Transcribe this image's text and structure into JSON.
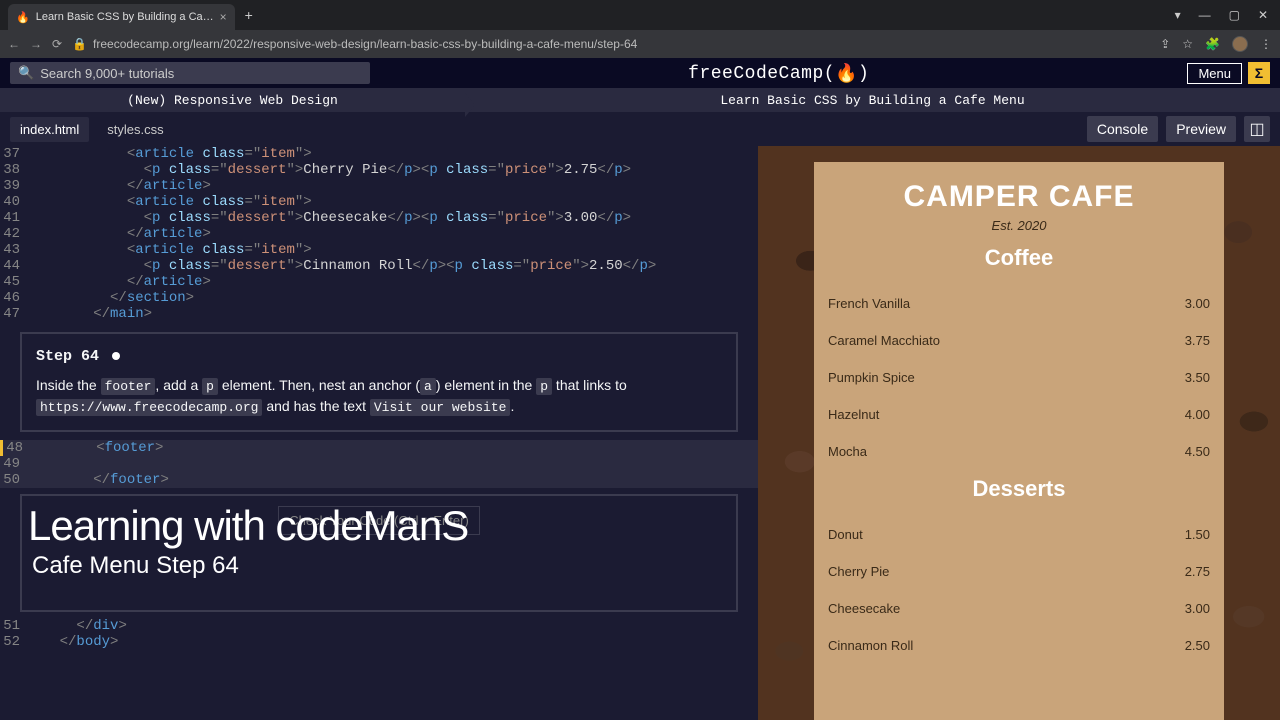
{
  "browser": {
    "tab_title": "Learn Basic CSS by Building a Ca…",
    "url": "freecodecamp.org/learn/2022/responsive-web-design/learn-basic-css-by-building-a-cafe-menu/step-64"
  },
  "topbar": {
    "search_placeholder": "Search 9,000+ tutorials",
    "brand": "freeCodeCamp(",
    "brand_suffix": ")",
    "menu_label": "Menu"
  },
  "crumbs": {
    "left": "(New) Responsive Web Design",
    "right": "Learn Basic CSS by Building a Cafe Menu"
  },
  "tabs": {
    "file1": "index.html",
    "file2": "styles.css",
    "console": "Console",
    "preview": "Preview"
  },
  "code": {
    "lines": [
      {
        "n": "37",
        "html": "            <span class='punct'>&lt;</span><span class='tag'>article</span> <span class='attr'>class</span><span class='punct'>=\"</span><span class='val'>item</span><span class='punct'>\"&gt;</span>"
      },
      {
        "n": "38",
        "html": "              <span class='punct'>&lt;</span><span class='tag'>p</span> <span class='attr'>class</span><span class='punct'>=\"</span><span class='val'>dessert</span><span class='punct'>\"&gt;</span><span class='txt'>Cherry Pie</span><span class='punct'>&lt;/</span><span class='tag'>p</span><span class='punct'>&gt;&lt;</span><span class='tag'>p</span> <span class='attr'>class</span><span class='punct'>=\"</span><span class='val'>price</span><span class='punct'>\"&gt;</span><span class='txt'>2.75</span><span class='punct'>&lt;/</span><span class='tag'>p</span><span class='punct'>&gt;</span>"
      },
      {
        "n": "39",
        "html": "            <span class='punct'>&lt;/</span><span class='tag'>article</span><span class='punct'>&gt;</span>"
      },
      {
        "n": "40",
        "html": "            <span class='punct'>&lt;</span><span class='tag'>article</span> <span class='attr'>class</span><span class='punct'>=\"</span><span class='val'>item</span><span class='punct'>\"&gt;</span>"
      },
      {
        "n": "41",
        "html": "              <span class='punct'>&lt;</span><span class='tag'>p</span> <span class='attr'>class</span><span class='punct'>=\"</span><span class='val'>dessert</span><span class='punct'>\"&gt;</span><span class='txt'>Cheesecake</span><span class='punct'>&lt;/</span><span class='tag'>p</span><span class='punct'>&gt;&lt;</span><span class='tag'>p</span> <span class='attr'>class</span><span class='punct'>=\"</span><span class='val'>price</span><span class='punct'>\"&gt;</span><span class='txt'>3.00</span><span class='punct'>&lt;/</span><span class='tag'>p</span><span class='punct'>&gt;</span>"
      },
      {
        "n": "42",
        "html": "            <span class='punct'>&lt;/</span><span class='tag'>article</span><span class='punct'>&gt;</span>"
      },
      {
        "n": "43",
        "html": "            <span class='punct'>&lt;</span><span class='tag'>article</span> <span class='attr'>class</span><span class='punct'>=\"</span><span class='val'>item</span><span class='punct'>\"&gt;</span>"
      },
      {
        "n": "44",
        "html": "              <span class='punct'>&lt;</span><span class='tag'>p</span> <span class='attr'>class</span><span class='punct'>=\"</span><span class='val'>dessert</span><span class='punct'>\"&gt;</span><span class='txt'>Cinnamon Roll</span><span class='punct'>&lt;/</span><span class='tag'>p</span><span class='punct'>&gt;&lt;</span><span class='tag'>p</span> <span class='attr'>class</span><span class='punct'>=\"</span><span class='val'>price</span><span class='punct'>\"&gt;</span><span class='txt'>2.50</span><span class='punct'>&lt;/</span><span class='tag'>p</span><span class='punct'>&gt;</span>"
      },
      {
        "n": "45",
        "html": "            <span class='punct'>&lt;/</span><span class='tag'>article</span><span class='punct'>&gt;</span>"
      },
      {
        "n": "46",
        "html": "          <span class='punct'>&lt;/</span><span class='tag'>section</span><span class='punct'>&gt;</span>"
      },
      {
        "n": "47",
        "html": "        <span class='punct'>&lt;/</span><span class='tag'>main</span><span class='punct'>&gt;</span>"
      }
    ],
    "editable": [
      {
        "n": "48",
        "html": "        <span class='punct'>&lt;</span><span class='tag'>footer</span><span class='punct'>&gt;</span>"
      },
      {
        "n": "49",
        "html": ""
      },
      {
        "n": "50",
        "html": "        <span class='punct'>&lt;/</span><span class='tag'>footer</span><span class='punct'>&gt;</span>"
      }
    ],
    "after": [
      {
        "n": "51",
        "html": "      <span class='punct'>&lt;/</span><span class='tag'>div</span><span class='punct'>&gt;</span>"
      },
      {
        "n": "52",
        "html": "    <span class='punct'>&lt;/</span><span class='tag'>body</span><span class='punct'>&gt;</span>"
      }
    ]
  },
  "step": {
    "title": "Step 64",
    "text_parts": [
      "Inside the ",
      "footer",
      ", add a ",
      "p",
      " element. Then, nest an anchor (",
      "a",
      ") element in the ",
      "p",
      " that links to ",
      "https://www.freecodecamp.org",
      " and has the text ",
      "Visit our website",
      "."
    ]
  },
  "check_label": "Check Your Code (Ctrl + Enter)",
  "overlay": {
    "title": "Learning with codeManS",
    "sub": "Cafe Menu Step 64"
  },
  "menu": {
    "title": "CAMPER CAFE",
    "est": "Est. 2020",
    "sections": [
      {
        "heading": "Coffee",
        "items": [
          {
            "name": "French Vanilla",
            "price": "3.00"
          },
          {
            "name": "Caramel Macchiato",
            "price": "3.75"
          },
          {
            "name": "Pumpkin Spice",
            "price": "3.50"
          },
          {
            "name": "Hazelnut",
            "price": "4.00"
          },
          {
            "name": "Mocha",
            "price": "4.50"
          }
        ]
      },
      {
        "heading": "Desserts",
        "items": [
          {
            "name": "Donut",
            "price": "1.50"
          },
          {
            "name": "Cherry Pie",
            "price": "2.75"
          },
          {
            "name": "Cheesecake",
            "price": "3.00"
          },
          {
            "name": "Cinnamon Roll",
            "price": "2.50"
          }
        ]
      }
    ]
  }
}
